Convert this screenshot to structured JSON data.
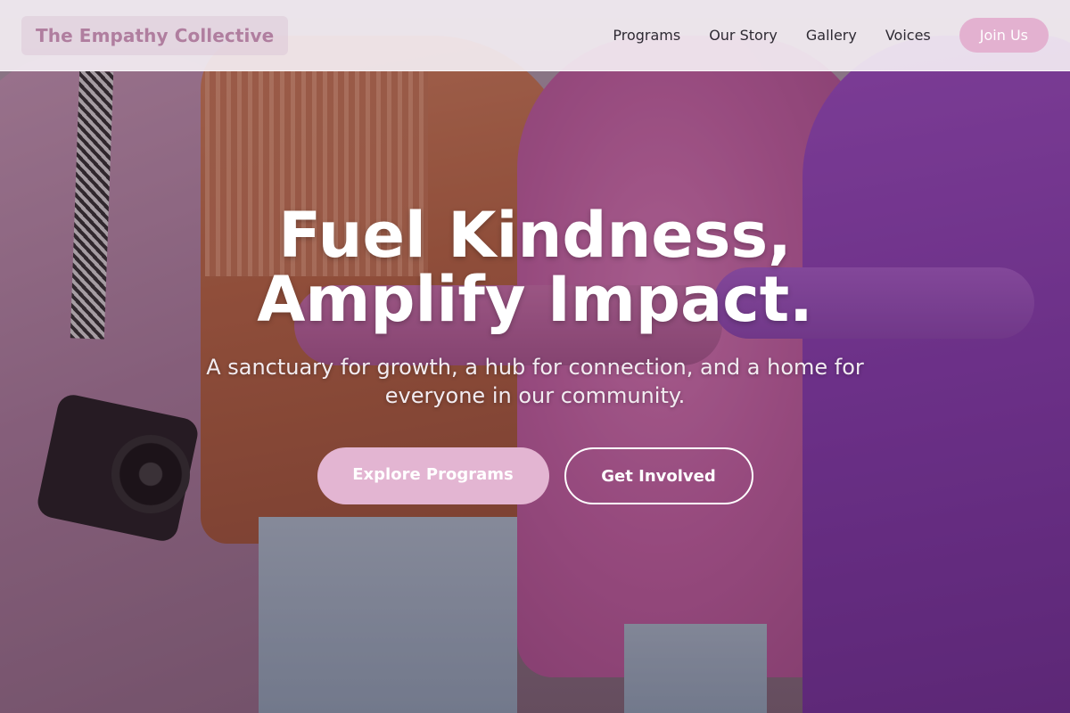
{
  "nav": {
    "brand": "The Empathy Collective",
    "links": [
      "Programs",
      "Our Story",
      "Gallery",
      "Voices"
    ],
    "cta": "Join Us"
  },
  "hero": {
    "title_line1": "Fuel Kindness,",
    "title_line2": "Amplify Impact.",
    "subtitle": "A sanctuary for growth, a hub for connection, and a home for everyone in our community.",
    "primary_button": "Explore Programs",
    "secondary_button": "Get Involved",
    "image": "group-hugging-photo"
  },
  "colors": {
    "accent": "#e3b5d2",
    "brand_text": "#b07e9f",
    "nav_text": "#2e2a33"
  }
}
